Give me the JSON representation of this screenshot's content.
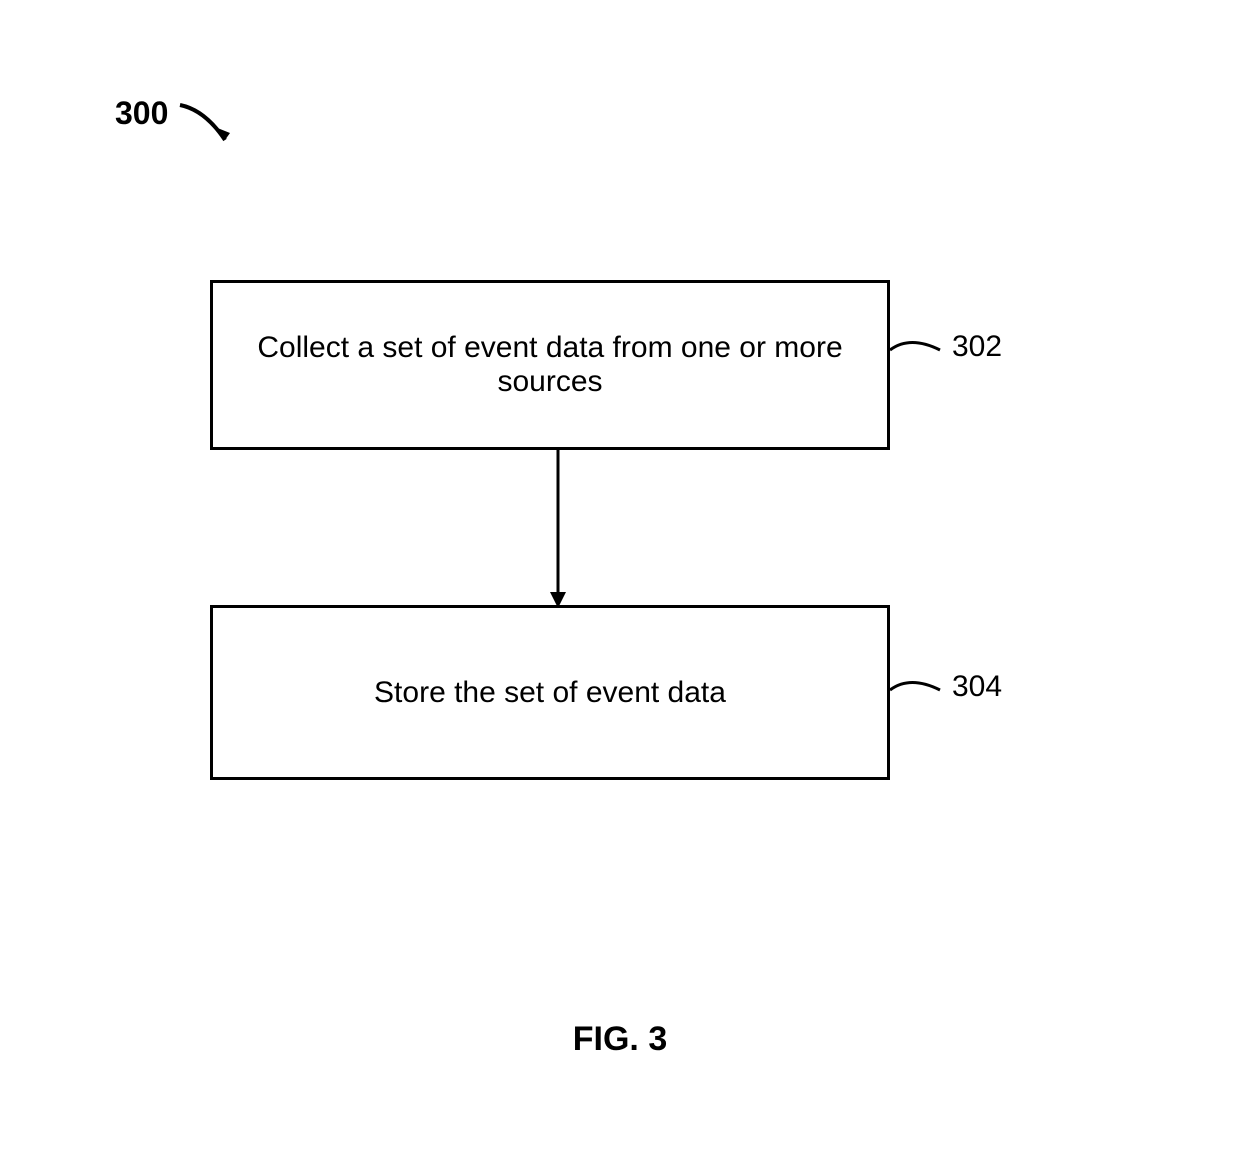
{
  "figure_number": "300",
  "steps": [
    {
      "ref": "302",
      "text": "Collect a set of event data from one or more sources"
    },
    {
      "ref": "304",
      "text": "Store the set of event data"
    }
  ],
  "caption": "FIG. 3"
}
